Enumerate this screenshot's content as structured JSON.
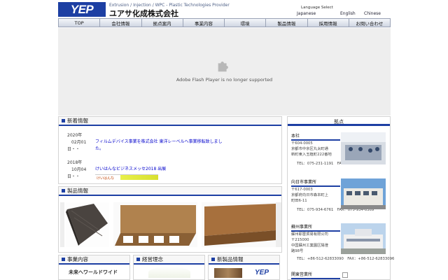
{
  "header": {
    "logo_text": "YEP",
    "tagline": "Extrusion / Injection / WPC - Plastic Technologies Provider",
    "company_name": "ユアサ化成株式会社",
    "language_title": "Language Select",
    "languages": [
      "Japanese",
      "English",
      "Chinese"
    ]
  },
  "nav": {
    "items": [
      "TOP",
      "会社情報",
      "拠点案内",
      "事業内容",
      "環境",
      "製品情報",
      "採用情報",
      "お問い合わせ"
    ]
  },
  "flash": {
    "message": "Adobe Flash Player is no longer supported",
    "icon": "plugin-icon"
  },
  "news": {
    "title": "新着情報",
    "items": [
      {
        "year": "2020年",
        "date": "02月01",
        "suffix": "日・・",
        "text_line1": "フィルムデバイス事業を株式会社 東洋レーベルへ事業移転致しまし",
        "text_line2": "た。"
      },
      {
        "year": "2018年",
        "date": "10月04",
        "suffix": "日・・",
        "text_line1": "けいはんなビジネスメッセ2018 出展",
        "banner": "けいはんな"
      }
    ]
  },
  "products": {
    "title": "製品情報"
  },
  "bottom": {
    "business_title": "事業内容",
    "business_caption": "未来へワールドワイド",
    "philosophy_title": "経営理念",
    "new_products_title": "新製品情報",
    "new_products_logo": "YEP"
  },
  "bases": {
    "title": "拠点",
    "offices": [
      {
        "name": "本社",
        "zip": "〒604-0005",
        "addr1": "京都市中京区丸太町通",
        "addr2": "新町東入玉植町222番地",
        "contact": "TEL：075-231-1191　FAX：075-256-4301"
      },
      {
        "name": "向日市事業所",
        "zip": "〒617-0003",
        "addr1": "京都府向日市森本町上",
        "addr2": "町田6-11",
        "contact": "TEL：075-934-6761　FAX：075-934-6369"
      },
      {
        "name": "蘇州事業所",
        "zip_pre": "蘇州耶雷貿易有限公司",
        "zip": "〒215000",
        "addr1": "中国蘇州工業園区陽澄",
        "addr2": "路98号",
        "contact": "TEL：+86-512-62833090　FAX：+86-512-62833096"
      },
      {
        "name": "関東営業所"
      }
    ]
  },
  "colors": {
    "brand_blue": "#1d3fa3",
    "link_blue": "#0000cc"
  }
}
